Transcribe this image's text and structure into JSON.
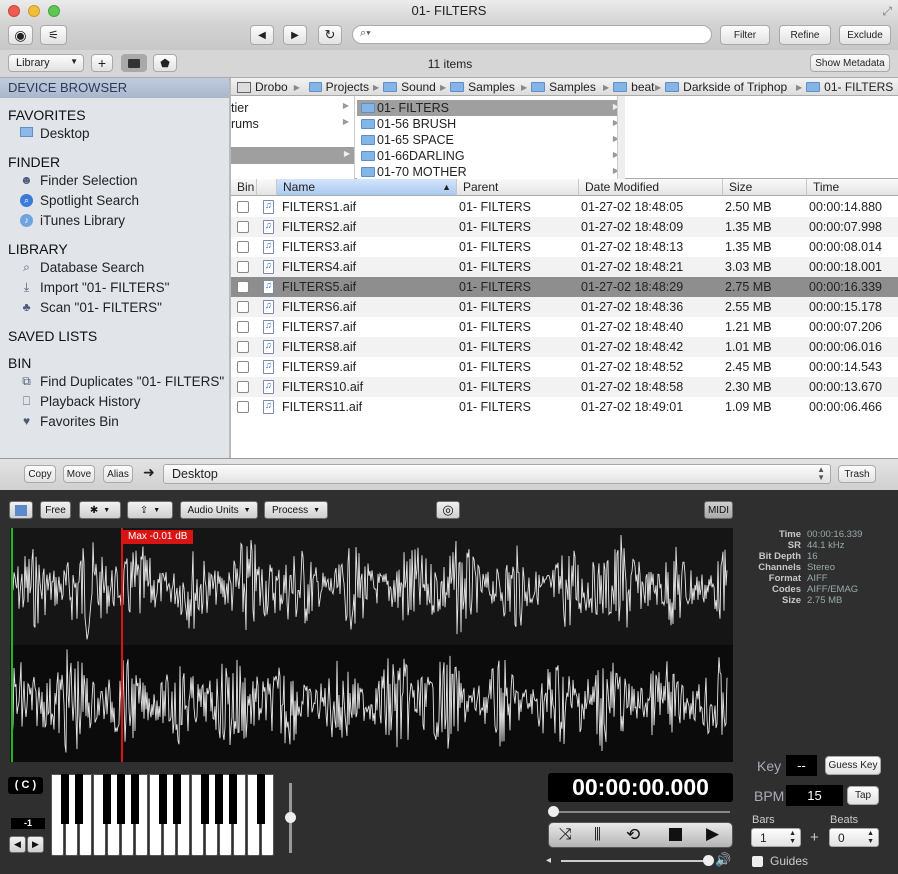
{
  "window": {
    "title": "01- FILTERS"
  },
  "toolbar": {
    "filter_label": "Filter",
    "refine_label": "Refine",
    "exclude_label": "Exclude",
    "search_placeholder": "",
    "library_select": "Library",
    "items_count": "11 items",
    "show_metadata_label": "Show Metadata"
  },
  "sidebar": {
    "header": "DEVICE BROWSER",
    "sections": [
      {
        "title": "FAVORITES",
        "items": [
          {
            "label": "Desktop",
            "icon": "folder-icon"
          }
        ]
      },
      {
        "title": "FINDER",
        "items": [
          {
            "label": "Finder Selection",
            "icon": "finder-icon"
          },
          {
            "label": "Spotlight Search",
            "icon": "spotlight-icon"
          },
          {
            "label": "iTunes Library",
            "icon": "itunes-icon"
          }
        ]
      },
      {
        "title": "LIBRARY",
        "items": [
          {
            "label": "Database Search",
            "icon": "search-icon"
          },
          {
            "label": "Import \"01- FILTERS\"",
            "icon": "import-icon"
          },
          {
            "label": "Scan \"01- FILTERS\"",
            "icon": "scan-icon"
          }
        ]
      },
      {
        "title": "SAVED LISTS",
        "items": []
      },
      {
        "title": "BIN",
        "items": [
          {
            "label": "Find Duplicates \"01- FILTERS\"",
            "icon": "duplicates-icon"
          },
          {
            "label": "Playback History",
            "icon": "history-icon"
          },
          {
            "label": "Favorites Bin",
            "icon": "heart-icon"
          }
        ]
      }
    ]
  },
  "path": [
    "Drobo",
    "Projects",
    "Sound",
    "Samples",
    "Samples",
    "beat",
    "Darkside of Triphop",
    "01- FILTERS"
  ],
  "columns": {
    "left": [
      "tier",
      "rums",
      ""
    ],
    "middle": [
      "01- FILTERS",
      "01-56 BRUSH",
      "01-65 SPACE",
      "01-66DARLING",
      "01-70 MOTHER"
    ]
  },
  "table": {
    "headers": [
      "Bin",
      "Name",
      "Parent",
      "Date Modified",
      "Size",
      "Time"
    ],
    "rows": [
      {
        "name": "FILTERS1.aif",
        "parent": "01- FILTERS",
        "date": "01-27-02 18:48:05",
        "size": "2.50 MB",
        "time": "00:00:14.880"
      },
      {
        "name": "FILTERS2.aif",
        "parent": "01- FILTERS",
        "date": "01-27-02 18:48:09",
        "size": "1.35 MB",
        "time": "00:00:07.998"
      },
      {
        "name": "FILTERS3.aif",
        "parent": "01- FILTERS",
        "date": "01-27-02 18:48:13",
        "size": "1.35 MB",
        "time": "00:00:08.014"
      },
      {
        "name": "FILTERS4.aif",
        "parent": "01- FILTERS",
        "date": "01-27-02 18:48:21",
        "size": "3.03 MB",
        "time": "00:00:18.001"
      },
      {
        "name": "FILTERS5.aif",
        "parent": "01- FILTERS",
        "date": "01-27-02 18:48:29",
        "size": "2.75 MB",
        "time": "00:00:16.339",
        "selected": true
      },
      {
        "name": "FILTERS6.aif",
        "parent": "01- FILTERS",
        "date": "01-27-02 18:48:36",
        "size": "2.55 MB",
        "time": "00:00:15.178"
      },
      {
        "name": "FILTERS7.aif",
        "parent": "01- FILTERS",
        "date": "01-27-02 18:48:40",
        "size": "1.21 MB",
        "time": "00:00:07.206"
      },
      {
        "name": "FILTERS8.aif",
        "parent": "01- FILTERS",
        "date": "01-27-02 18:48:42",
        "size": "1.01 MB",
        "time": "00:00:06.016"
      },
      {
        "name": "FILTERS9.aif",
        "parent": "01- FILTERS",
        "date": "01-27-02 18:48:52",
        "size": "2.45 MB",
        "time": "00:00:14.543"
      },
      {
        "name": "FILTERS10.aif",
        "parent": "01- FILTERS",
        "date": "01-27-02 18:48:58",
        "size": "2.30 MB",
        "time": "00:00:13.670"
      },
      {
        "name": "FILTERS11.aif",
        "parent": "01- FILTERS",
        "date": "01-27-02 18:49:01",
        "size": "1.09 MB",
        "time": "00:00:06.466"
      }
    ]
  },
  "actions": {
    "copy": "Copy",
    "move": "Move",
    "alias": "Alias",
    "destination": "Desktop",
    "trash": "Trash"
  },
  "player": {
    "free_label": "Free",
    "audio_units_label": "Audio Units",
    "process_label": "Process",
    "midi_label": "MIDI",
    "max_label": "Max -0.01 dB",
    "info_labels": [
      "Time",
      "SR",
      "Bit Depth",
      "Channels",
      "Format",
      "Codes",
      "Size"
    ],
    "info_values": [
      "00:00:16.339",
      "44.1 kHz",
      "16",
      "Stereo",
      "AIFF",
      "AIFF/EMAG",
      "2.75 MB"
    ],
    "key_display": "( C )",
    "octave": "-1",
    "timecode": "00:00:00.000",
    "key_label": "Key",
    "key_value": "--",
    "guess_key_label": "Guess Key",
    "bpm_label": "BPM",
    "bpm_value": "15",
    "tap_label": "Tap",
    "bars_label": "Bars",
    "bars_value": "1",
    "beats_label": "Beats",
    "beats_value": "0",
    "guides_label": "Guides",
    "playhead_position": 0.155,
    "accent_red": "#d81414",
    "accent_green": "#27b327"
  }
}
